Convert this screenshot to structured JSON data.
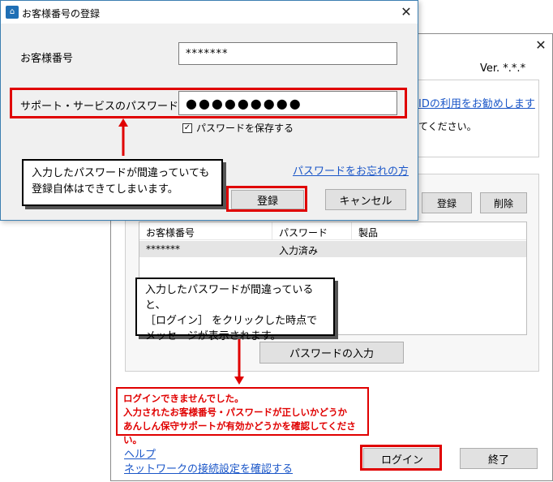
{
  "main_window": {
    "version": "Ver. *.*.*",
    "id_link": "IDの利用をお勧めします",
    "info_text": "てください。",
    "register_button": "登録",
    "delete_button": "削除",
    "list": {
      "columns": [
        "お客様番号",
        "パスワード",
        "製品"
      ],
      "rows": [
        {
          "number": "*******",
          "password": "入力済み",
          "product": ""
        }
      ]
    },
    "password_input_button": "パスワードの入力",
    "help_link": "ヘルプ",
    "network_link": "ネットワークの接続設定を確認する",
    "login_button": "ログイン",
    "exit_button": "終了"
  },
  "dialog": {
    "title": "お客様番号の登録",
    "customer_number_label": "お客様番号",
    "customer_number_value": "*******",
    "password_label": "サポート・サービスのパスワード",
    "password_value": "●●●●●●●●●",
    "save_password_label": "パスワードを保存する",
    "save_password_checked": true,
    "forgot_link": "パスワードをお忘れの方",
    "register_button": "登録",
    "cancel_button": "キャンセル"
  },
  "annotations": {
    "callout1": [
      "入力したパスワードが間違っていても",
      "登録自体はできてしまいます。"
    ],
    "callout2": [
      "入力したパスワードが間違っていると、",
      "［ログイン］ をクリックした時点で",
      "メッセージが表示されます。"
    ],
    "error_message": [
      "ログインできませんでした。",
      "入力されたお客様番号・パスワードが正しいかどうか",
      "あんしん保守サポートが有効かどうかを確認してください。"
    ]
  },
  "colors": {
    "annotation_red": "#e00000",
    "link_blue": "#1a56c8",
    "dialog_border": "#3c7fb1"
  }
}
